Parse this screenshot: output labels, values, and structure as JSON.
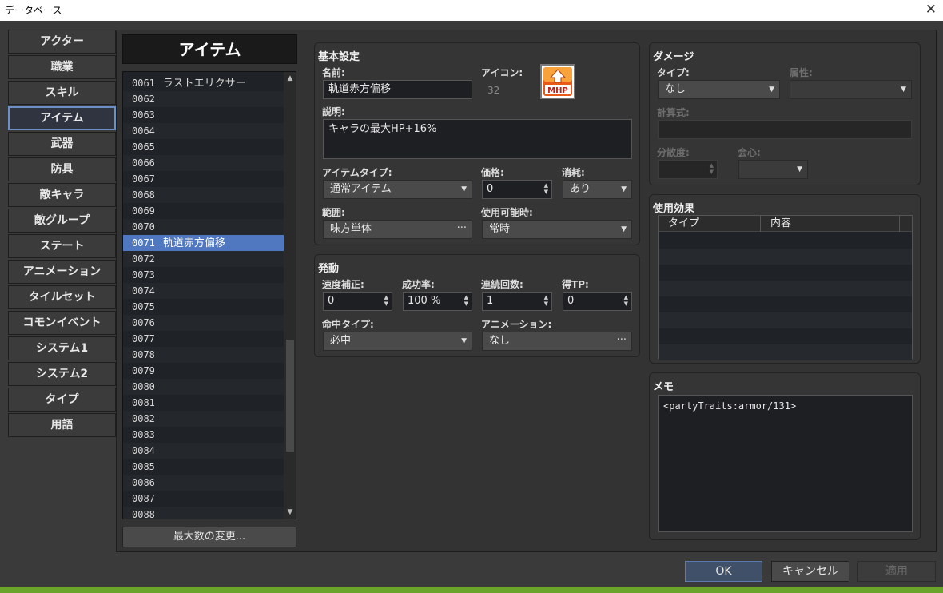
{
  "window": {
    "title": "データベース",
    "close_glyph": "✕"
  },
  "categories": [
    {
      "label": "アクター"
    },
    {
      "label": "職業"
    },
    {
      "label": "スキル"
    },
    {
      "label": "アイテム",
      "selected": true
    },
    {
      "label": "武器"
    },
    {
      "label": "防具"
    },
    {
      "label": "敵キャラ"
    },
    {
      "label": "敵グループ"
    },
    {
      "label": "ステート"
    },
    {
      "label": "アニメーション"
    },
    {
      "label": "タイルセット"
    },
    {
      "label": "コモンイベント"
    },
    {
      "label": "システム1"
    },
    {
      "label": "システム2"
    },
    {
      "label": "タイプ"
    },
    {
      "label": "用語"
    }
  ],
  "list": {
    "title": "アイテム",
    "items": [
      {
        "id": "0061",
        "name": "ラストエリクサー"
      },
      {
        "id": "0062",
        "name": ""
      },
      {
        "id": "0063",
        "name": ""
      },
      {
        "id": "0064",
        "name": ""
      },
      {
        "id": "0065",
        "name": ""
      },
      {
        "id": "0066",
        "name": ""
      },
      {
        "id": "0067",
        "name": ""
      },
      {
        "id": "0068",
        "name": ""
      },
      {
        "id": "0069",
        "name": ""
      },
      {
        "id": "0070",
        "name": ""
      },
      {
        "id": "0071",
        "name": "軌道赤方偏移",
        "selected": true
      },
      {
        "id": "0072",
        "name": ""
      },
      {
        "id": "0073",
        "name": ""
      },
      {
        "id": "0074",
        "name": ""
      },
      {
        "id": "0075",
        "name": ""
      },
      {
        "id": "0076",
        "name": ""
      },
      {
        "id": "0077",
        "name": ""
      },
      {
        "id": "0078",
        "name": ""
      },
      {
        "id": "0079",
        "name": ""
      },
      {
        "id": "0080",
        "name": ""
      },
      {
        "id": "0081",
        "name": ""
      },
      {
        "id": "0082",
        "name": ""
      },
      {
        "id": "0083",
        "name": ""
      },
      {
        "id": "0084",
        "name": ""
      },
      {
        "id": "0085",
        "name": ""
      },
      {
        "id": "0086",
        "name": ""
      },
      {
        "id": "0087",
        "name": ""
      },
      {
        "id": "0088",
        "name": ""
      }
    ],
    "max_button": "最大数の変更..."
  },
  "basic": {
    "title": "基本設定",
    "name_label": "名前:",
    "name_value": "軌道赤方偏移",
    "icon_label": "アイコン:",
    "icon_index": "32",
    "icon_text": "MHP",
    "desc_label": "説明:",
    "desc_value": "キャラの最大HP+16%",
    "itemtype_label": "アイテムタイプ:",
    "itemtype_value": "通常アイテム",
    "price_label": "価格:",
    "price_value": "0",
    "consume_label": "消耗:",
    "consume_value": "あり",
    "scope_label": "範囲:",
    "scope_value": "味方単体",
    "occasion_label": "使用可能時:",
    "occasion_value": "常時"
  },
  "invocation": {
    "title": "発動",
    "speed_label": "速度補正:",
    "speed_value": "0",
    "success_label": "成功率:",
    "success_value": "100 %",
    "repeat_label": "連続回数:",
    "repeat_value": "1",
    "tp_label": "得TP:",
    "tp_value": "0",
    "hittype_label": "命中タイプ:",
    "hittype_value": "必中",
    "anim_label": "アニメーション:",
    "anim_value": "なし"
  },
  "damage": {
    "title": "ダメージ",
    "type_label": "タイプ:",
    "type_value": "なし",
    "element_label": "属性:",
    "formula_label": "計算式:",
    "variance_label": "分散度:",
    "critical_label": "会心:"
  },
  "effects": {
    "title": "使用効果",
    "col_type": "タイプ",
    "col_content": "内容"
  },
  "memo": {
    "title": "メモ",
    "text": "<partyTraits:armor/131>"
  },
  "buttons": {
    "ok": "OK",
    "cancel": "キャンセル",
    "apply": "適用"
  },
  "glyphs": {
    "down": "▼",
    "up": "▲",
    "updown": "▲\n▼",
    "dots": "···"
  }
}
